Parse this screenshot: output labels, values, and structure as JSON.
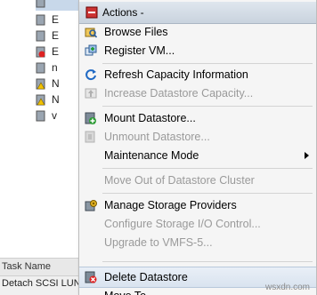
{
  "background": {
    "tree_rows": [
      {
        "text": "E",
        "icon": "datastore-icon"
      },
      {
        "text": "E",
        "icon": "datastore-icon"
      },
      {
        "text": "E",
        "icon": "datastore-alert-icon"
      },
      {
        "text": "n",
        "icon": "datastore-icon"
      },
      {
        "text": "N",
        "icon": "datastore-warning-icon"
      },
      {
        "text": "N",
        "icon": "datastore-warning-icon"
      },
      {
        "text": "v",
        "icon": "datastore-icon"
      }
    ],
    "tasks_header": "Task Name",
    "task_row": "Detach SCSI LUN"
  },
  "menu": {
    "title": "Actions -",
    "items": [
      {
        "label": "Browse Files",
        "icon": "browse-files-icon",
        "disabled": false
      },
      {
        "label": "Register VM...",
        "icon": "register-vm-icon",
        "disabled": false
      },
      {
        "label": "Refresh Capacity Information",
        "icon": "refresh-icon",
        "disabled": false
      },
      {
        "label": "Increase Datastore Capacity...",
        "icon": "increase-capacity-icon",
        "disabled": true
      },
      {
        "label": "Mount Datastore...",
        "icon": "mount-datastore-icon",
        "disabled": false
      },
      {
        "label": "Unmount Datastore...",
        "icon": "unmount-datastore-icon",
        "disabled": true
      },
      {
        "label": "Maintenance Mode",
        "icon": "",
        "disabled": false,
        "submenu": true
      },
      {
        "label": "Move Out of Datastore Cluster",
        "icon": "",
        "disabled": true
      },
      {
        "label": "Manage Storage Providers",
        "icon": "storage-providers-icon",
        "disabled": false
      },
      {
        "label": "Configure Storage I/O Control...",
        "icon": "",
        "disabled": true
      },
      {
        "label": "Upgrade to VMFS-5...",
        "icon": "",
        "disabled": true
      },
      {
        "label": "Delete Datastore",
        "icon": "delete-datastore-icon",
        "disabled": false,
        "highlighted": true
      },
      {
        "label": "Move To...",
        "icon": "",
        "disabled": false
      }
    ]
  },
  "colors": {
    "highlight": "#d9e3ef",
    "disabled_text": "#9a9a9a",
    "menu_bg": "#f5f5f5"
  },
  "watermark": "wsxdn.com"
}
